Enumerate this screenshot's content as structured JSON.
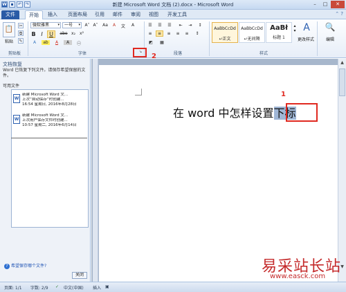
{
  "window": {
    "title": "新建 Microsoft Word 文档 (2).docx - Microsoft Word",
    "minimize": "–",
    "maximize": "□",
    "close": "✕"
  },
  "qat": {
    "word": "W",
    "save": "▪",
    "undo": "↶",
    "redo": "↷"
  },
  "tabs": [
    {
      "label": "文件"
    },
    {
      "label": "开始"
    },
    {
      "label": "插入"
    },
    {
      "label": "页面布局"
    },
    {
      "label": "引用"
    },
    {
      "label": "邮件"
    },
    {
      "label": "审阅"
    },
    {
      "label": "视图"
    },
    {
      "label": "开发工具"
    }
  ],
  "ribbon": {
    "clipboard": {
      "paste": "粘贴",
      "label": "剪贴板"
    },
    "font": {
      "name": "微软雅黑",
      "size": "一号",
      "bold": "B",
      "italic": "I",
      "underline": "U",
      "strike": "abe",
      "sub": "x₂",
      "sup": "x²",
      "grow": "A˄",
      "shrink": "A˅",
      "case": "Aa",
      "clear": "A",
      "color": "A",
      "label": "字体"
    },
    "paragraph": {
      "label": "段落"
    },
    "styles": {
      "items": [
        {
          "sample": "AaBbCcDd",
          "name": "↵正文"
        },
        {
          "sample": "AaBbCcDd",
          "name": "↵无间隔"
        },
        {
          "sample": "AaBł",
          "name": "标题 1"
        }
      ],
      "change": "更改样式",
      "label": "样式"
    },
    "edit": "编辑"
  },
  "callouts": {
    "one": "1",
    "two": "2"
  },
  "recovery": {
    "title": "文档恢复",
    "message": "Word 已恢复下列文件。请保存希望保留的文件。",
    "available": "可用文件",
    "files": [
      {
        "name": "新建 Microsoft Word 文...",
        "desc": "上次“自动保存”时创建...",
        "time": "16:54 星期日, 2016年8月28日"
      },
      {
        "name": "新建 Microsoft Word 文...",
        "desc": "上次用户保存文件时创建...",
        "time": "10:57 星期二, 2016年6月14日"
      }
    ],
    "help": "希望保存哪个文件?",
    "close": "关闭"
  },
  "document": {
    "text_before": "在 word 中怎样设置",
    "text_selected": "下标"
  },
  "status": {
    "page": "页面: 1/1",
    "words": "字数: 2/9",
    "lang": "中文(中国)",
    "mode": "插入"
  },
  "watermark": {
    "name": "易采站长站",
    "url": "www.easck.com"
  }
}
